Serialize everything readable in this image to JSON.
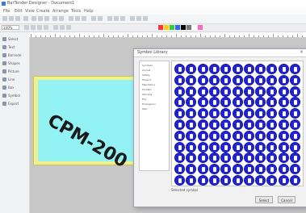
{
  "window": {
    "title": "BarTender Designer - Document1"
  },
  "menu": {
    "items": [
      "File",
      "Edit",
      "View",
      "Create",
      "Arrange",
      "Tools",
      "Help"
    ]
  },
  "toolbar": {
    "zoom_value": "100%",
    "palette": [
      "#ff3333",
      "#ffcc00",
      "#33cc33",
      "#3366ff",
      "#000000",
      "#777777",
      "#ffffff",
      "#ff66cc"
    ]
  },
  "sidebar": {
    "items": [
      "Select",
      "Text",
      "Barcode",
      "Shapes",
      "Picture",
      "Line",
      "Box",
      "Symbol",
      "Export"
    ]
  },
  "label": {
    "text": "CPM-200",
    "outer_color": "#f2f08a",
    "inner_color": "#93f2f4"
  },
  "dialog": {
    "title": "Symbol Library",
    "tree_items": [
      "Symbols",
      "Arrows",
      "Safety",
      "Hazard",
      "Mandatory",
      "Prohibit",
      "Warning",
      "Fire",
      "Emergency",
      "Misc"
    ],
    "footer_text": "Selected symbol",
    "buttons": [
      "Select",
      "Cancel"
    ],
    "symbol_color": "#2222d6"
  }
}
